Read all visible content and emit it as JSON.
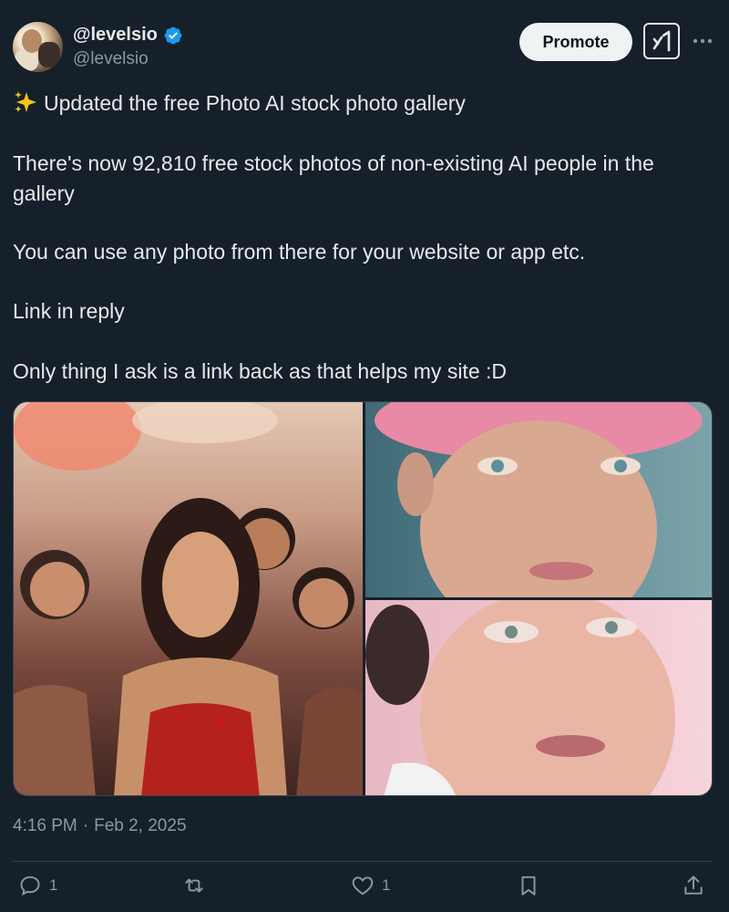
{
  "author": {
    "display_name": "@levelsio",
    "handle": "@levelsio",
    "verified": true
  },
  "header": {
    "promote_label": "Promote",
    "grok_icon": "grok-icon",
    "more_icon": "more-options-icon"
  },
  "tweet": {
    "lines": [
      "Updated the free Photo AI stock photo gallery",
      "There's now 92,810 free stock photos of non-existing AI people in the gallery",
      "You can use any photo from there for your website or app etc.",
      "Link in reply",
      "Only thing I ask is a link back as that helps my site :D"
    ],
    "time": "4:16 PM",
    "separator": "·",
    "date": "Feb 2, 2025"
  },
  "media": {
    "count": 3
  },
  "actions": {
    "reply_count": "1",
    "repost_count": "",
    "like_count": "1",
    "icons": [
      "reply-icon",
      "repost-icon",
      "like-icon",
      "bookmark-icon",
      "share-icon"
    ]
  },
  "colors": {
    "background": "#15202b",
    "text": "#e7e9ea",
    "secondary_text": "#8b98a5",
    "verified_blue": "#1d9bf0",
    "divider": "#38444d"
  }
}
